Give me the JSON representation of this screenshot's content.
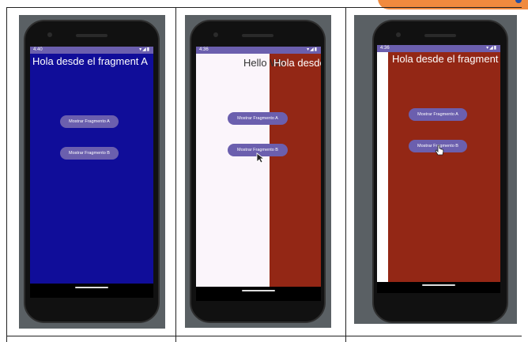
{
  "panels": [
    {
      "status_time": "4:40",
      "status_icons": "▾◢▮",
      "screen_title": "Hola desde el fragment A",
      "button_a": "Mostrar Fragmento A",
      "button_b": "Mostrar Fragmento B",
      "background_color": "#100d99"
    },
    {
      "status_time": "4:36",
      "status_icons": "▾◢▮",
      "hello_text": "Hello Wo",
      "screen_title": "Hola desde",
      "button_a": "Mostrar Fragmento A",
      "button_b": "Mostrar Fragmento B",
      "left_color": "#fbf5fb",
      "right_color": "#932715"
    },
    {
      "status_time": "4:36",
      "status_icons": "▾◢▮",
      "screen_title": "Hola desde el fragment",
      "button_a": "Mostrar Fragmento A",
      "button_b": "Mostrar Fragmento B",
      "background_color": "#932715"
    }
  ],
  "colors": {
    "button": "#6b5fae",
    "status_bar": "#6b5fae",
    "accent_orange": "#f08a3e"
  }
}
